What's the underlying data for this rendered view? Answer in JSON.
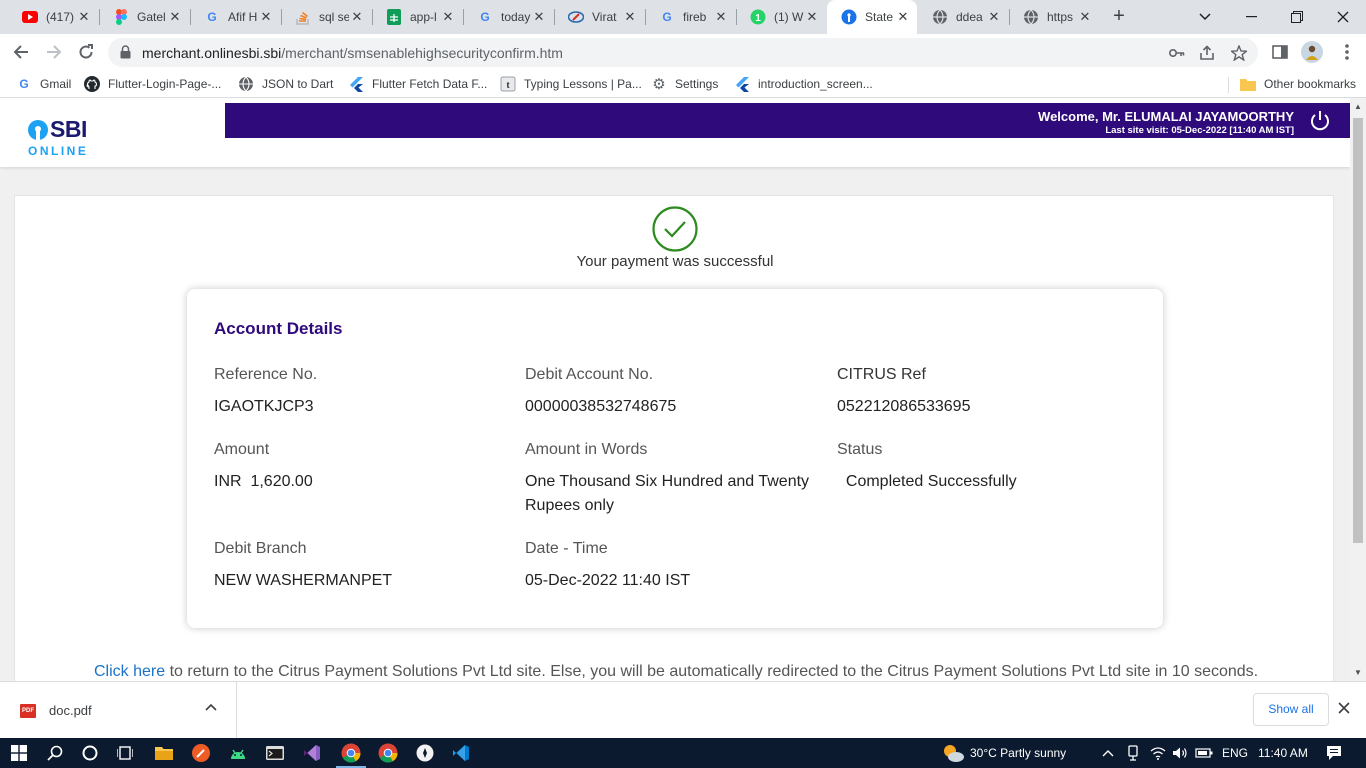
{
  "tabs": [
    {
      "title": "(417)",
      "icon": "youtube-icon",
      "color": "#ff0000"
    },
    {
      "title": "Gatel",
      "icon": "figma-icon",
      "color": "#f24e1e"
    },
    {
      "title": "Afif H",
      "icon": "google-icon",
      "color": "#4285f4"
    },
    {
      "title": "sql se",
      "icon": "stackoverflow-icon",
      "color": "#f48024"
    },
    {
      "title": "app-l",
      "icon": "sheets-icon",
      "color": "#0f9d58"
    },
    {
      "title": "today",
      "icon": "google-icon",
      "color": "#4285f4"
    },
    {
      "title": "Virat",
      "icon": "cricbuzz-icon",
      "color": "#2b6cb0"
    },
    {
      "title": "fireb",
      "icon": "google-icon",
      "color": "#4285f4"
    },
    {
      "title": "(1) W",
      "icon": "whatsapp-icon",
      "color": "#25d366"
    },
    {
      "title": "State",
      "icon": "sbi-icon",
      "color": "#1a73e8",
      "active": true
    },
    {
      "title": "ddea",
      "icon": "globe-icon",
      "color": "#5f6368"
    },
    {
      "title": "https",
      "icon": "globe-icon",
      "color": "#5f6368"
    }
  ],
  "omnibox": {
    "host": "merchant.onlinesbi.sbi",
    "path": "/merchant/smsenablehighsecurityconfirm.htm"
  },
  "bookmarks": [
    {
      "label": "Gmail",
      "icon": "google-icon"
    },
    {
      "label": "Flutter-Login-Page-...",
      "icon": "github-icon"
    },
    {
      "label": "JSON to Dart",
      "icon": "globe-icon"
    },
    {
      "label": "Flutter Fetch Data F...",
      "icon": "flutter-icon"
    },
    {
      "label": "Typing Lessons | Pa...",
      "icon": "typing-icon"
    },
    {
      "label": "Settings",
      "icon": "gear-icon"
    },
    {
      "label": "introduction_screen...",
      "icon": "flutter-icon"
    }
  ],
  "other_bookmarks": "Other bookmarks",
  "site": {
    "logo_top": "SBI",
    "logo_bottom": "ONLINE",
    "welcome": "Welcome, Mr. ELUMALAI JAYAMOORTHY",
    "last_visit": "Last site visit: 05-Dec-2022 [11:40 AM IST]"
  },
  "payment": {
    "success_message": "Your payment was successful",
    "section_title": "Account Details",
    "fields": [
      {
        "label": "Reference No.",
        "value": "IGAOTKJCP3"
      },
      {
        "label": "Debit Account No.",
        "value": "00000038532748675"
      },
      {
        "label": "CITRUS Ref",
        "value": "052212086533695"
      },
      {
        "label": "Amount",
        "value": "INR  1,620.00"
      },
      {
        "label": "Amount in Words",
        "value": "One Thousand Six Hundred and Twenty Rupees only"
      },
      {
        "label": "Status",
        "value": "  Completed Successfully"
      },
      {
        "label": "Debit Branch",
        "value": "NEW WASHERMANPET"
      },
      {
        "label": "Date - Time",
        "value": "05-Dec-2022 11:40 IST"
      }
    ],
    "redirect_link": "Click here",
    "redirect_text": " to return to the Citrus Payment Solutions Pvt Ltd site. Else, you will be automatically redirected to the Citrus Payment Solutions Pvt Ltd site in 10 seconds."
  },
  "downloads": {
    "file_name": "doc.pdf",
    "file_badge": "PDF",
    "show_all": "Show all"
  },
  "taskbar": {
    "weather": "30°C  Partly sunny",
    "language": "ENG",
    "time": "11:40 AM"
  },
  "colors": {
    "brand_purple": "#2f0a7a",
    "sbi_blue": "#1da1f2",
    "success_green": "#2e8b1f",
    "link_blue": "#1a73c8"
  }
}
